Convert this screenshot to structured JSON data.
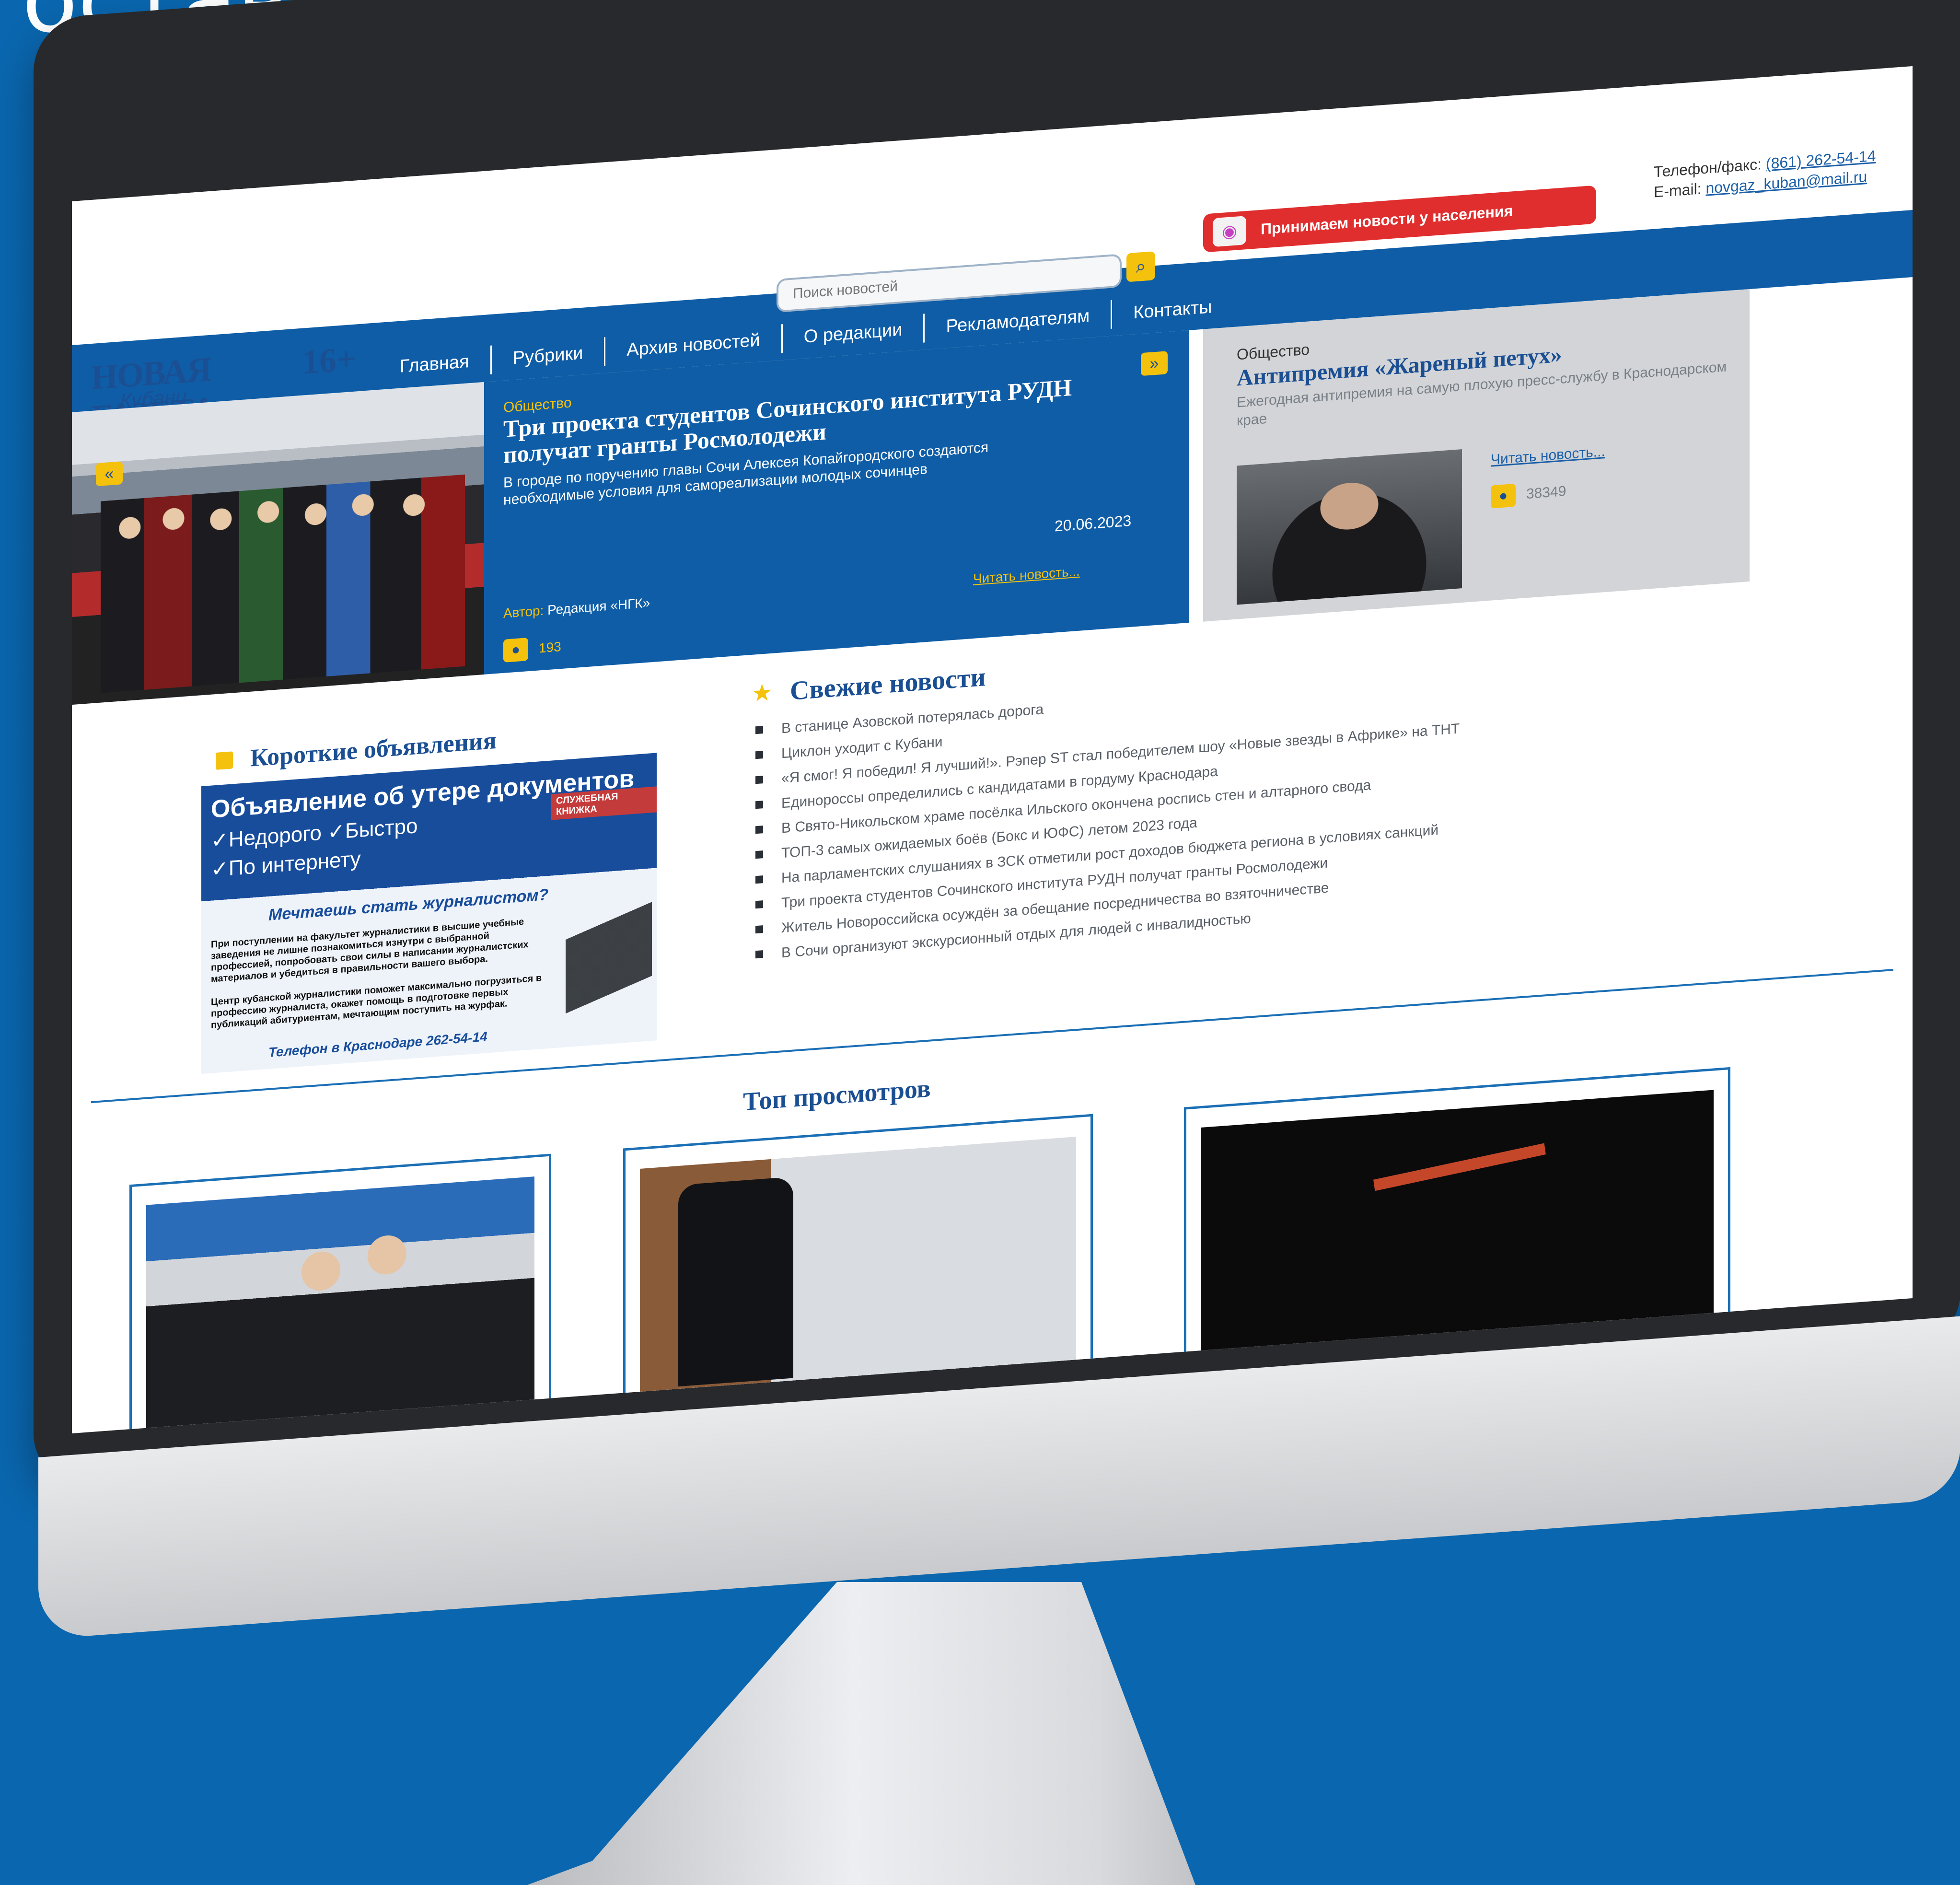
{
  "slide": {
    "headline": "оставаться"
  },
  "site": {
    "logo_main": "НОВАЯ ГАЗЕТА",
    "logo_sub": "Кубани",
    "age_rating": "16+",
    "search_placeholder": "Поиск новостей",
    "report_button": "Принимаем новости у населения",
    "phone_label": "Телефон/факс:",
    "phone": "(861) 262-54-14",
    "email_label": "E-mail:",
    "email": "novgaz_kuban@mail.ru",
    "nav": [
      "Главная",
      "Рубрики",
      "Архив новостей",
      "О редакции",
      "Рекламодателям",
      "Контакты"
    ]
  },
  "hero": {
    "rubric": "Общество",
    "title": "Три проекта студентов Сочинского института РУДН получат гранты Росмолодежи",
    "lead": "В городе по поручению главы Сочи Алексея Копайгородского создаются необходимые условия для самореализации молодых сочинцев",
    "date": "20.06.2023",
    "author_label": "Автор:",
    "author": "Редакция «НГК»",
    "read_more": "Читать новость...",
    "views": "193"
  },
  "side": {
    "rubric": "Общество",
    "title": "Антипремия «Жареный петух»",
    "lead": "Ежегодная антипремия на самую плохую пресс-службу в Краснодарском крае",
    "read_more": "Читать новость...",
    "views": "38349"
  },
  "ads": {
    "title": "Короткие объявления",
    "line1": "Объявление об утере документов",
    "line2": "✓Недорого ✓Быстро",
    "line3": "✓По интернету",
    "tag": "СЛУЖЕБНАЯ КНИЖКА",
    "question": "Мечтаешь стать журналистом?",
    "body1": "При поступлении на факультет журналистики в высшие учебные заведения не лишне познакомиться изнутри с выбранной профессией, попробовать свои силы в написании журналистских материалов и убедиться в правильности вашего выбора.",
    "body2": "Центр кубанской журналистики поможет максимально погрузиться в профессию журналиста, окажет помощь в подготовке первых публикаций абитуриентам, мечтающим поступить на журфак.",
    "phone": "Телефон в Краснодаре 262-54-14"
  },
  "fresh": {
    "title": "Свежие новости",
    "items": [
      "В станице Азовской потерялась дорога",
      "Циклон уходит с Кубани",
      "«Я смог! Я победил! Я лучший!». Рэпер ST стал победителем шоу «Новые звезды в Африке» на ТНТ",
      "Единороссы определились с кандидатами в гордуму Краснодара",
      "В Свято-Никольском храме посёлка Ильского окончена роспись стен и алтарного свода",
      "ТОП-3 самых ожидаемых боёв (Бокс и ЮФС) летом 2023 года",
      "На парламентских слушаниях в ЗСК отметили рост доходов бюджета региона в условиях санкций",
      "Три проекта студентов Сочинского института РУДН получат гранты Росмолодежи",
      "Житель Новороссийска осуждён за обещание посредничества во взяточничестве",
      "В Сочи организуют экскурсионный отдых для людей с инвалидностью"
    ]
  },
  "top": {
    "title": "Топ просмотров"
  },
  "icons": {
    "search": "search-icon",
    "report": "microphone-icon",
    "prev": "chevron-left-icon",
    "next": "chevron-right-icon",
    "views": "eye-icon",
    "star": "star-icon"
  },
  "colors": {
    "background": "#0a66ae",
    "brand_blue": "#0f5da6",
    "accent_yellow": "#f4c20d",
    "report_red": "#e02e2e"
  }
}
